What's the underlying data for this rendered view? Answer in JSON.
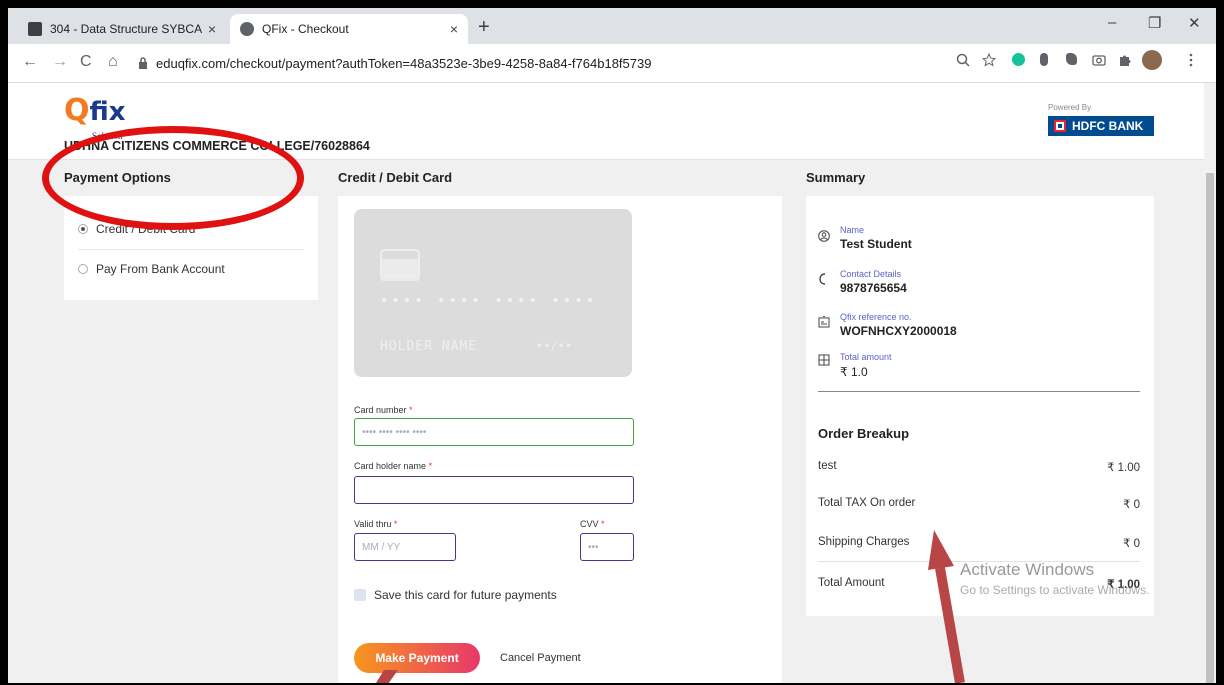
{
  "browser": {
    "tabs": [
      {
        "label": "304 - Data Structure SYBCA",
        "close": "×"
      },
      {
        "label": "QFix - Checkout",
        "close": "×"
      }
    ],
    "new_tab": "+",
    "window_controls": {
      "minimize": "–",
      "restore": "❐",
      "close": "✕"
    },
    "nav": {
      "back": "←",
      "forward": "→",
      "reload": "C",
      "home": "⌂"
    },
    "url": "eduqfix.com/checkout/payment?authToken=48a3523e-3be9-4258-8a84-f764b18f5739"
  },
  "header": {
    "logo_q": "Q",
    "logo_fix": "fix",
    "logo_sub": "Solution",
    "college": "UDHNA CITIZENS COMMERCE COLLEGE/76028864",
    "powered_by": "Powered By",
    "bank": "HDFC BANK"
  },
  "payment_options": {
    "heading": "Payment Options",
    "items": [
      {
        "label": "Credit / Debit Card",
        "selected": true
      },
      {
        "label": "Pay From Bank Account",
        "selected": false
      }
    ]
  },
  "card_form": {
    "heading": "Credit / Debit Card",
    "card_preview": {
      "number": "•••• •••• •••• ••••",
      "holder": "HOLDER NAME",
      "expiry": "••/••"
    },
    "card_number": {
      "label": "Card number",
      "placeholder": "•••• •••• •••• ••••"
    },
    "holder_name": {
      "label": "Card holder name",
      "placeholder": ""
    },
    "valid_thru": {
      "label": "Valid thru",
      "placeholder": "MM / YY"
    },
    "cvv": {
      "label": "CVV",
      "placeholder": "•••"
    },
    "required_mark": "*",
    "save_card": "Save this card for future payments",
    "make_payment": "Make Payment",
    "cancel_payment": "Cancel Payment"
  },
  "summary": {
    "heading": "Summary",
    "name": {
      "label": "Name",
      "value": "Test Student"
    },
    "contact": {
      "label": "Contact Details",
      "value": "9878765654"
    },
    "reference": {
      "label": "Qfix reference no.",
      "value": "WOFNHCXY2000018"
    },
    "total": {
      "label": "Total amount",
      "value": "₹ 1.0"
    },
    "order_breakup": {
      "heading": "Order Breakup",
      "rows": [
        {
          "label": "test",
          "amount": "₹ 1.00"
        },
        {
          "label": "Total TAX On order",
          "amount": "₹ 0"
        },
        {
          "label": "Shipping Charges",
          "amount": "₹ 0"
        },
        {
          "label": "Total Amount",
          "amount": "₹ 1.00"
        }
      ]
    }
  },
  "watermark": {
    "line1": "Activate Windows",
    "line2": "Go to Settings to activate Windows."
  },
  "colors": {
    "annotation_red": "#e01111",
    "arrow_red": "#b84646",
    "accent_orange": "#f7961e",
    "accent_pink": "#e8386b",
    "hdfc_blue": "#004c8f"
  }
}
